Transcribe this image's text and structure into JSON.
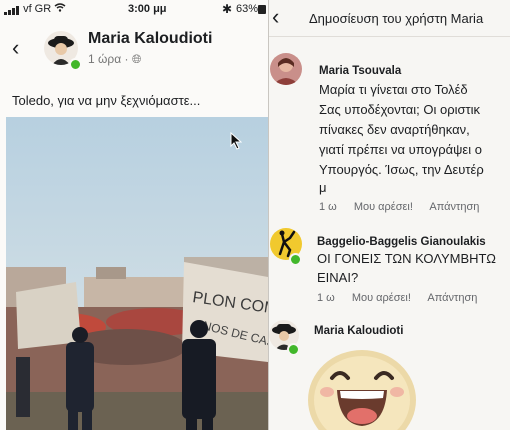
{
  "status": {
    "carrier": "vf GR",
    "time": "3:00 μμ",
    "battery": "63%"
  },
  "post": {
    "author": "Maria Kaloudioti",
    "time": "1 ώρα",
    "text": "Toledo, για να μην ξεχνιόμαστε...",
    "photo_signs": [
      "PLON COMP",
      "NOS DE CAS"
    ]
  },
  "comments_view": {
    "title": "Δημοσίευση του χρήστη Maria",
    "comments": [
      {
        "author": "Maria Tsouvala",
        "lines": [
          "Μαρία τι γίνεται στο Τολέδ",
          "Σας υποδέχονται; Οι οριστικ",
          "πίνακες δεν αναρτήθηκαν,",
          "γιατί πρέπει να υπογράψει ο",
          "Υπουργός. Ίσως, την Δευτέρ",
          "μ"
        ],
        "time": "1 ω",
        "like": "Μου αρέσει!",
        "reply": "Απάντηση"
      },
      {
        "author": "Baggelio-Baggelis Gianoulakis",
        "lines": [
          "ΟΙ ΓΟΝΕΙΣ ΤΩΝ ΚΟΛΥΜΒΗΤΩ",
          "ΕΙΝΑΙ?"
        ],
        "time": "1 ω",
        "like": "Μου αρέσει!",
        "reply": "Απάντηση"
      },
      {
        "author": "Maria Kaloudioti",
        "lines": [],
        "time": "",
        "like": "",
        "reply": ""
      }
    ]
  }
}
